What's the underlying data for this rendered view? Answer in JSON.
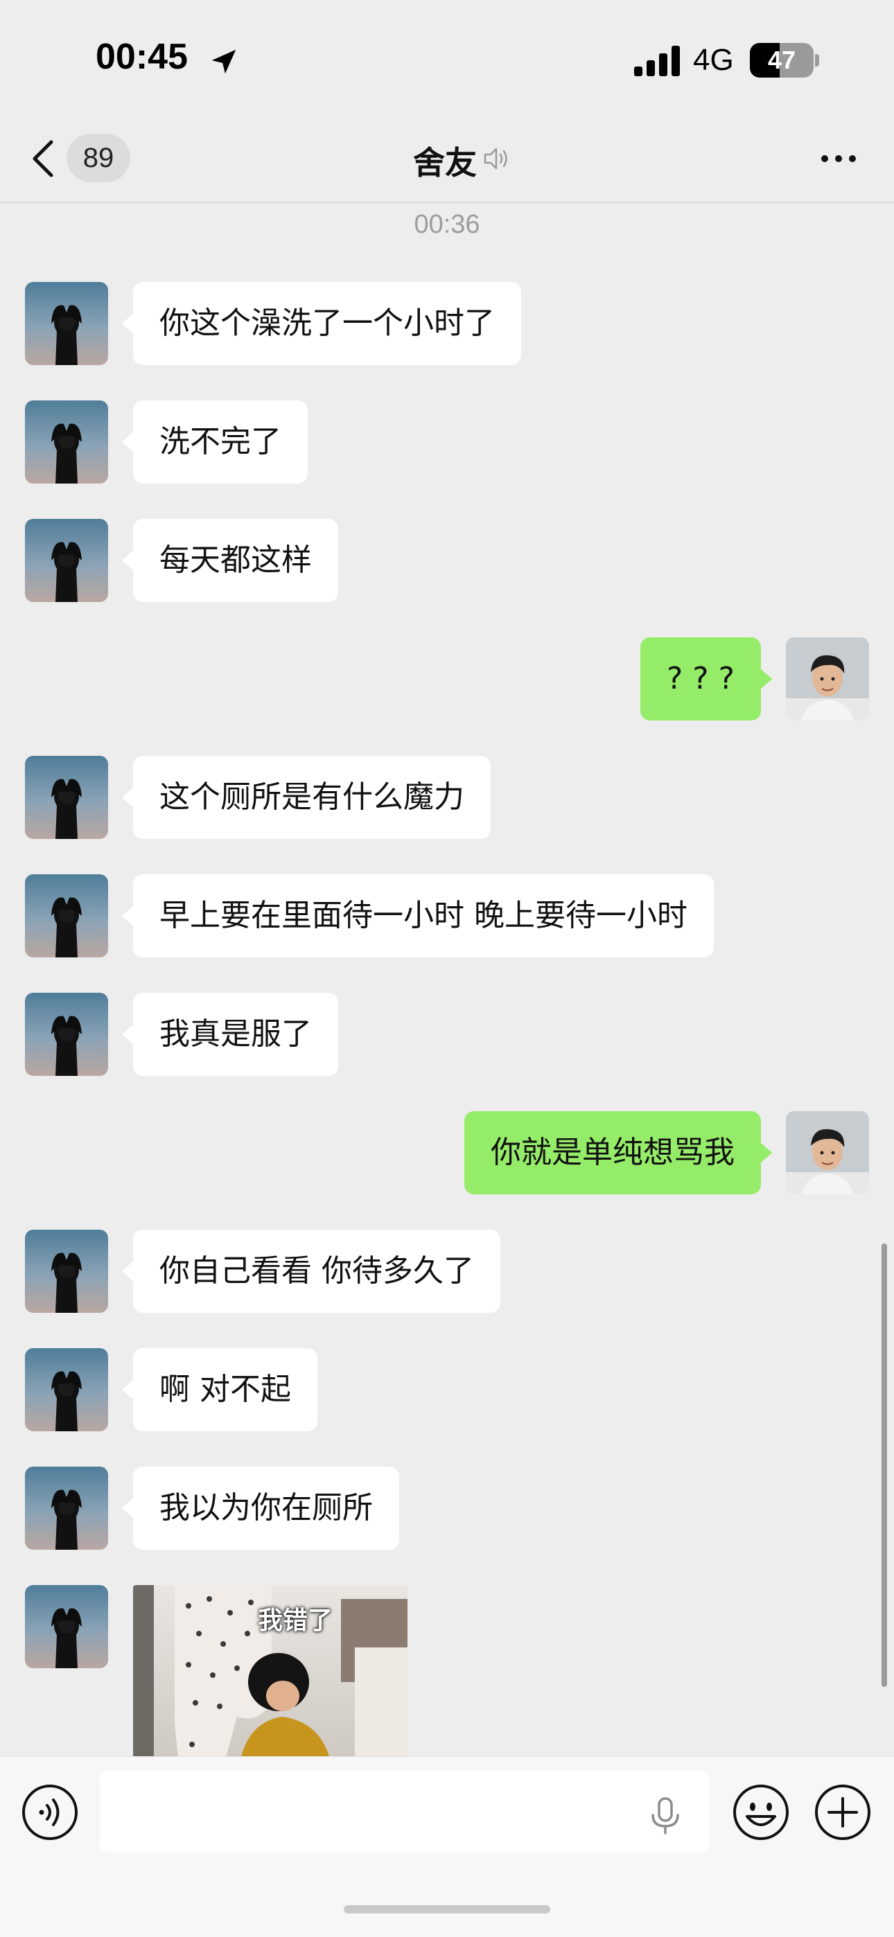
{
  "status_bar": {
    "time": "00:45",
    "network": "4G",
    "battery": "47",
    "battery_level": 0.47
  },
  "nav": {
    "unread_count": "89",
    "title": "舍友"
  },
  "chat": {
    "timestamp": "00:36",
    "messages": [
      {
        "side": "in",
        "text": "你这个澡洗了一个小时了"
      },
      {
        "side": "in",
        "text": "洗不完了"
      },
      {
        "side": "in",
        "text": "每天都这样"
      },
      {
        "side": "out",
        "text": "? ? ?"
      },
      {
        "side": "in",
        "text": "这个厕所是有什么魔力"
      },
      {
        "side": "in",
        "text": "早上要在里面待一小时 晚上要待一小时"
      },
      {
        "side": "in",
        "text": "我真是服了"
      },
      {
        "side": "out",
        "text": "你就是单纯想骂我"
      },
      {
        "side": "in",
        "text": "你自己看看 你待多久了"
      },
      {
        "side": "in",
        "text": "啊 对不起"
      },
      {
        "side": "in",
        "text": "我以为你在厕所"
      }
    ],
    "sticker_caption": "我错了"
  },
  "input": {
    "value": "",
    "placeholder": ""
  },
  "colors": {
    "background": "#ededed",
    "incoming_bubble": "#ffffff",
    "outgoing_bubble": "#95ec69",
    "timestamp": "#9d9d9d"
  },
  "icons": {
    "back": "chevron-left-icon",
    "mute": "speaker-muted-icon",
    "more": "more-dots-icon",
    "voice": "voice-icon",
    "mic": "mic-icon",
    "emoji": "emoji-icon",
    "plus": "plus-icon"
  }
}
